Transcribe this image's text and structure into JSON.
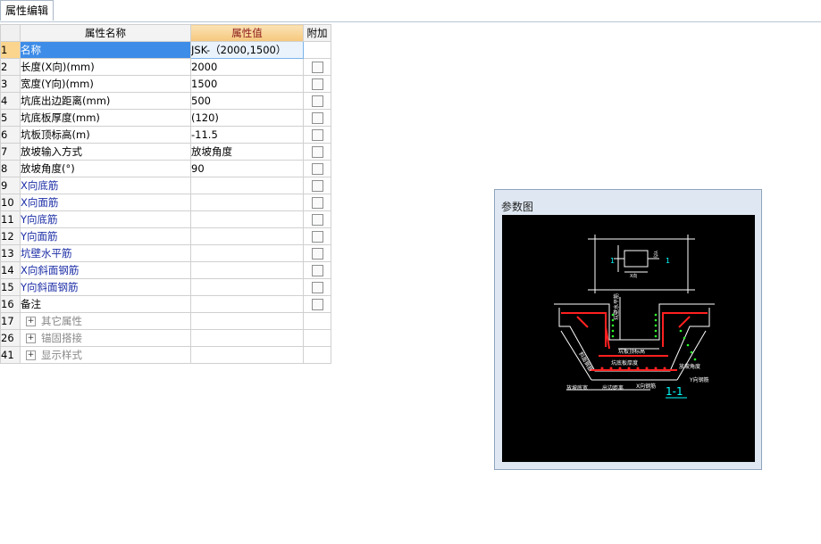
{
  "tab": {
    "label": "属性编辑"
  },
  "grid": {
    "headers": {
      "name": "属性名称",
      "value": "属性值",
      "extra": "附加"
    },
    "rows": [
      {
        "num": "1",
        "name": "名称",
        "value": "JSK-（2000,1500）",
        "has_check": false
      },
      {
        "num": "2",
        "name": "长度(X向)(mm)",
        "value": "2000",
        "has_check": true
      },
      {
        "num": "3",
        "name": "宽度(Y向)(mm)",
        "value": "1500",
        "has_check": true
      },
      {
        "num": "4",
        "name": "坑底出边距离(mm)",
        "value": "500",
        "has_check": true
      },
      {
        "num": "5",
        "name": "坑底板厚度(mm)",
        "value": "(120)",
        "has_check": true
      },
      {
        "num": "6",
        "name": "坑板顶标高(m)",
        "value": "-11.5",
        "has_check": true
      },
      {
        "num": "7",
        "name": "放坡输入方式",
        "value": "放坡角度",
        "has_check": true
      },
      {
        "num": "8",
        "name": "放坡角度(°)",
        "value": "90",
        "has_check": true
      },
      {
        "num": "9",
        "name": "X向底筋",
        "value": "",
        "has_check": true
      },
      {
        "num": "10",
        "name": "X向面筋",
        "value": "",
        "has_check": true
      },
      {
        "num": "11",
        "name": "Y向底筋",
        "value": "",
        "has_check": true
      },
      {
        "num": "12",
        "name": "Y向面筋",
        "value": "",
        "has_check": true
      },
      {
        "num": "13",
        "name": "坑壁水平筋",
        "value": "",
        "has_check": true
      },
      {
        "num": "14",
        "name": "X向斜面钢筋",
        "value": "",
        "has_check": true
      },
      {
        "num": "15",
        "name": "Y向斜面钢筋",
        "value": "",
        "has_check": true
      },
      {
        "num": "16",
        "name": "备注",
        "value": "",
        "has_check": true
      }
    ],
    "groups": [
      {
        "num": "17",
        "name": "其它属性"
      },
      {
        "num": "26",
        "name": "锚固搭接"
      },
      {
        "num": "41",
        "name": "显示样式"
      }
    ]
  },
  "panel": {
    "title": "参数图",
    "labels": {
      "one": "1",
      "x_dir": "X向",
      "y_dir": "Y向",
      "wall_h": "坑壁水平筋",
      "slope_top": "坑板顶标高",
      "slope_steel": "斜面钢筋",
      "bottom_thick": "坑底板厚度",
      "slope_angle": "放坡角度",
      "y_bottom": "Y向钢筋",
      "slope_width": "放坡底宽",
      "edge_dist": "出边距离",
      "x_steel": "X向钢筋",
      "section": "1-1"
    }
  },
  "colors": {
    "accent_orange": "#f6c77c",
    "selection_blue": "#3d8ce8",
    "rebar_red": "#ff2020",
    "dots_green": "#2cff2c"
  }
}
